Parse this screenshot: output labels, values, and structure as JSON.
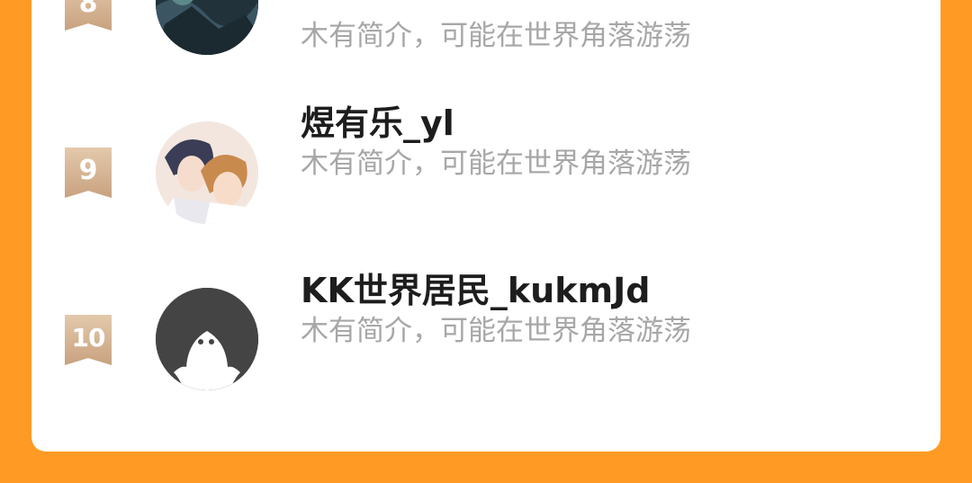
{
  "rows": [
    {
      "rank": "8",
      "name": "",
      "desc": "木有简介，可能在世界角落游荡",
      "avatar": "anime-avatar-dark-icon"
    },
    {
      "rank": "9",
      "name": "煜有乐_yl",
      "desc": "木有简介，可能在世界角落游荡",
      "avatar": "anime-avatar-couple-icon"
    },
    {
      "rank": "10",
      "name": "KK世界居民_kukmJd",
      "desc": "木有简介，可能在世界角落游荡",
      "avatar": "default-avatar-icon"
    }
  ],
  "colors": {
    "background": "#FF9A24",
    "card": "#FFFFFF",
    "rank_badge": "#D4B394",
    "name": "#1D1D1D",
    "desc": "#A7A7A7"
  }
}
